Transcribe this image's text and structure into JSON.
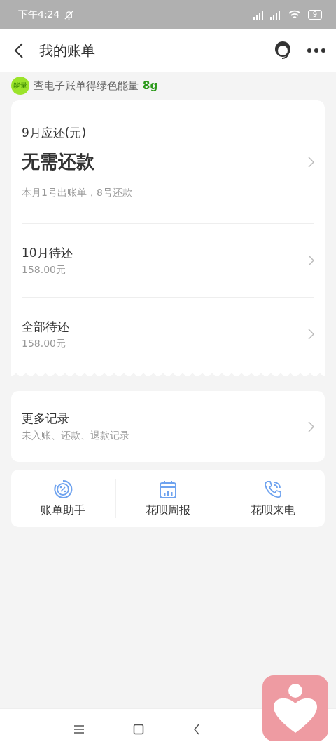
{
  "status_bar": {
    "time": "下午4:24",
    "battery": "9"
  },
  "header": {
    "title": "我的账单"
  },
  "banner": {
    "badge": "能量",
    "text": "查电子账单得绿色能量",
    "amount": "8g"
  },
  "bill": {
    "label": "9月应还(元)",
    "amount": "无需还款",
    "note": "本月1号出账单，8号还款"
  },
  "pending": [
    {
      "title": "10月待还",
      "amount": "158.00元"
    },
    {
      "title": "全部待还",
      "amount": "158.00元"
    }
  ],
  "records": {
    "title": "更多记录",
    "subtitle": "未入账、还款、退款记录"
  },
  "tools": [
    {
      "kind": "assistant",
      "label": "账单助手"
    },
    {
      "kind": "weekly",
      "label": "花呗周报"
    },
    {
      "kind": "call",
      "label": "花呗来电"
    }
  ]
}
